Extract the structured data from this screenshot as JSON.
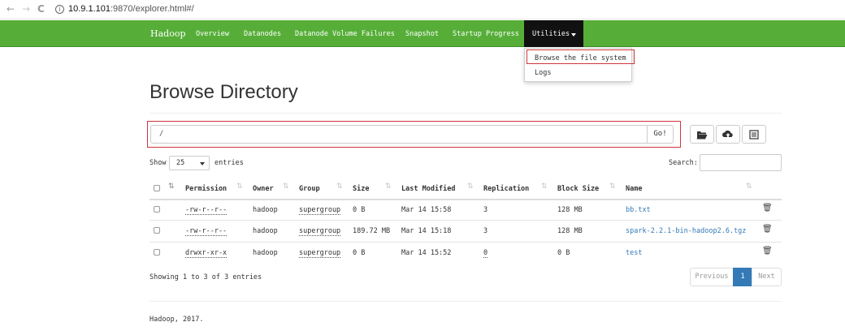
{
  "browser": {
    "url_host": "10.9.1.101",
    "url_rest": ":9870/explorer.html#/",
    "back_icon": "←",
    "forward_icon": "→",
    "reload_icon": "C",
    "info_icon": "i"
  },
  "navbar": {
    "brand": "Hadoop",
    "links": [
      "Overview",
      "Datanodes",
      "Datanode Volume Failures",
      "Snapshot",
      "Startup Progress"
    ],
    "utilities": "Utilities",
    "bg_color": "#56ae38"
  },
  "dropdown": {
    "items": [
      "Browse the file system",
      "Logs"
    ]
  },
  "page": {
    "title": "Browse Directory",
    "path_value": "/",
    "go_label": "Go!"
  },
  "controls": {
    "show_label": "Show",
    "entries_value": "25",
    "entries_label": "entries",
    "search_label": "Search:"
  },
  "table": {
    "headers": [
      "Permission",
      "Owner",
      "Group",
      "Size",
      "Last Modified",
      "Replication",
      "Block Size",
      "Name"
    ],
    "rows": [
      {
        "permission": "-rw-r--r--",
        "owner": "hadoop",
        "group": "supergroup",
        "size": "0 B",
        "modified": "Mar 14 15:58",
        "replication": "3",
        "block_size": "128 MB",
        "name": "bb.txt"
      },
      {
        "permission": "-rw-r--r--",
        "owner": "hadoop",
        "group": "supergroup",
        "size": "189.72 MB",
        "modified": "Mar 14 15:18",
        "replication": "3",
        "block_size": "128 MB",
        "name": "spark-2.2.1-bin-hadoop2.6.tgz"
      },
      {
        "permission": "drwxr-xr-x",
        "owner": "hadoop",
        "group": "supergroup",
        "size": "0 B",
        "modified": "Mar 14 15:52",
        "replication": "0",
        "block_size": "0 B",
        "name": "test"
      }
    ]
  },
  "footer": {
    "showing": "Showing 1 to 3 of 3 entries",
    "prev_label": "Previous",
    "page_number": "1",
    "next_label": "Next",
    "copyright": "Hadoop, 2017."
  }
}
